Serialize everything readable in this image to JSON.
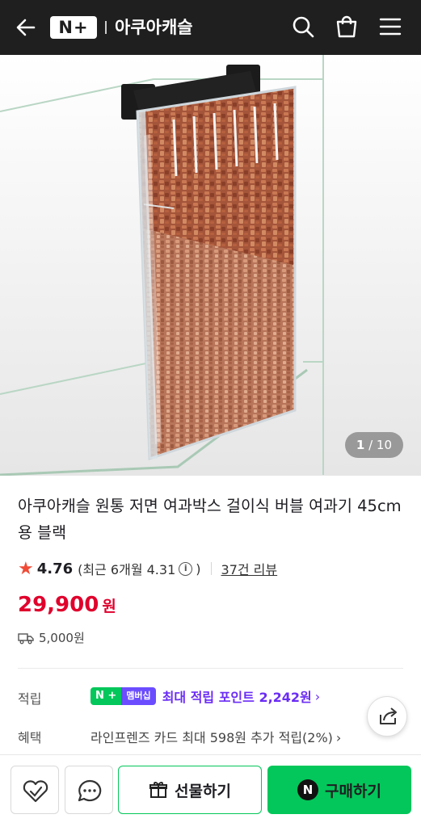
{
  "header": {
    "logo_text": "N+",
    "store_name": "아쿠아캐슬",
    "icons": [
      "back-arrow-icon",
      "search-icon",
      "shopping-bag-icon",
      "menu-icon"
    ]
  },
  "gallery": {
    "current": "1",
    "total": "/ 10"
  },
  "product": {
    "title": "아쿠아캐슬 원통 저면 여과박스 걸이식 버블 여과기 45cm용 블랙",
    "rating": "4.76",
    "recent_rating_label": "(최근 6개월 4.31",
    "recent_rating_close": ")",
    "review_count": "37건 리뷰",
    "price": "29,900",
    "price_unit": "원",
    "shipping_fee": "5,000원"
  },
  "benefits": {
    "points_label": "적립",
    "badge_left": "N +",
    "badge_right": "멤버십",
    "points_text": "최대 적립 포인트 2,242원",
    "benefit_label": "혜택",
    "benefit_text": "라인프렌즈 카드 최대 598원 추가 적립(2%)"
  },
  "bottom_bar": {
    "gift_label": "선물하기",
    "buy_label": "구매하기"
  },
  "colors": {
    "header_bg": "#1f1f1f",
    "price_red": "#e0002c",
    "naver_green": "#03c75a",
    "points_purple": "#6b2cf5",
    "star": "#f04a36"
  }
}
